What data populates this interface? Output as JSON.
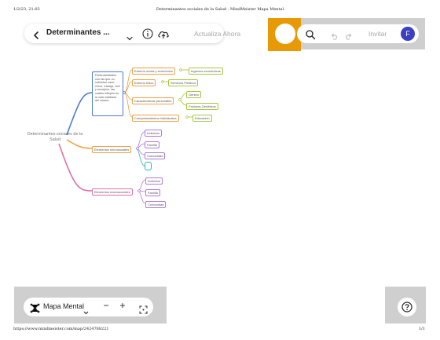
{
  "print": {
    "datetime": "1/2/23, 21:03",
    "page_title": "Determinantes sociales de la Salud - MindMeister Mapa Mental",
    "url": "https://www.mindmeister.com/map/2424788221",
    "page_number": "1/1"
  },
  "toolbar": {
    "map_title": "Determinantes ...",
    "sync_status": "Actualiza Ahora"
  },
  "right_toolbar": {
    "invite_label": "Invitar",
    "avatar_initial": "F"
  },
  "bottom_toolbar": {
    "view_label": "Mapa Mental",
    "zoom_out": "−",
    "zoom_in": "+"
  },
  "colors": {
    "accent_orange": "#e89a06",
    "avatar": "#3b3fc4",
    "branch_blue": "#4a7ad6",
    "branch_orange": "#f0a040",
    "branch_pink": "#e070a8",
    "node_green": "#a6c83c",
    "node_violet": "#b078e0",
    "node_cyan": "#2bb0c8"
  },
  "mindmap": {
    "root": "Determinantes sociales de la Salud",
    "branch1": {
      "text": "Particularidades con las que un individuo nace, crece, trabaja, vive y envejece, las cuales influyen en la vida cotidiana del mismo.",
      "children": [
        {
          "label": "Entorno social y económico",
          "child": "Ingresos económicos"
        },
        {
          "label": "Entorno físico",
          "child": "Servicios Públicos"
        },
        {
          "label": "Características personales",
          "children": [
            "Genero",
            "Factores Genéticos"
          ]
        },
        {
          "label": "Comportamientos individuales",
          "child": "Educación"
        }
      ]
    },
    "branch2": {
      "label": "Elementos microsociales",
      "children": [
        "Individuo",
        "Familia",
        "Comunidad",
        ""
      ]
    },
    "branch3": {
      "label": "Elementos macrosociales",
      "children": [
        "Individuo",
        "Familia",
        "Comunidad"
      ]
    }
  }
}
